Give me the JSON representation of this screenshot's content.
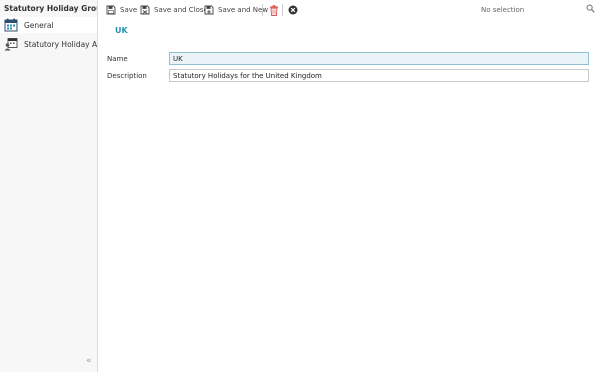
{
  "sidebar": {
    "title": "Statutory Holiday Group",
    "items": [
      {
        "label": "General",
        "icon": "calendar-icon",
        "active": true
      },
      {
        "label": "Statutory Holiday Assig",
        "icon": "calendar-people-icon",
        "active": false
      }
    ],
    "collapse_icon": "double-chevron-left-icon"
  },
  "toolbar": {
    "save_label": "Save",
    "save_close_label": "Save and Close",
    "save_new_label": "Save and New",
    "delete_icon": "trash-icon",
    "close_icon": "close-circle-icon"
  },
  "selection": {
    "value": "No selection",
    "icon": "search-icon"
  },
  "record": {
    "title": "UK"
  },
  "form": {
    "name_label": "Name",
    "name_value": "UK",
    "description_label": "Description",
    "description_value": "Statutory Holidays for the United Kingdom"
  },
  "colors": {
    "accent": "#2a8fb0",
    "delete": "#d9534f",
    "focus_border": "#8fc1d3"
  }
}
